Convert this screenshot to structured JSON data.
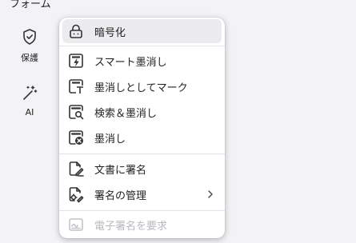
{
  "sidebar": {
    "top_label": "フォーム",
    "items": [
      {
        "label": "保護",
        "icon": "shield-check-icon"
      },
      {
        "label": "AI",
        "icon": "magic-wand-icon"
      }
    ]
  },
  "menu": {
    "items": [
      {
        "label": "暗号化",
        "icon": "lock-icon"
      },
      {
        "label": "スマート墨消し",
        "icon": "smart-redact-icon"
      },
      {
        "label": "墨消しとしてマーク",
        "icon": "mark-redact-icon"
      },
      {
        "label": "検索＆墨消し",
        "icon": "search-redact-icon"
      },
      {
        "label": "墨消し",
        "icon": "redact-icon"
      },
      {
        "label": "文書に署名",
        "icon": "sign-document-icon"
      },
      {
        "label": "署名の管理",
        "icon": "manage-signatures-icon"
      },
      {
        "label": "電子署名を要求",
        "icon": "request-esign-icon"
      }
    ]
  }
}
